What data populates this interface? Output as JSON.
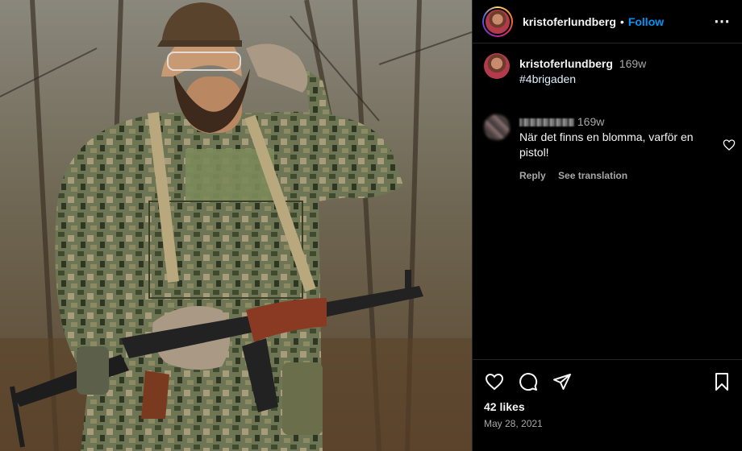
{
  "post": {
    "username": "kristoferlundberg",
    "follow_label": "Follow",
    "more_label": "•••"
  },
  "caption": {
    "username": "kristoferlundberg",
    "time": "169w",
    "text": "#4brigaden"
  },
  "comment": {
    "time": "169w",
    "text": "När det finns en blomma, varför en pistol!",
    "reply_label": "Reply",
    "translate_label": "See translation"
  },
  "footer": {
    "likes": "42 likes",
    "date": "May 28, 2021"
  },
  "icons": {
    "like": "heart-icon",
    "comment": "comment-icon",
    "share": "share-icon",
    "save": "bookmark-icon",
    "more": "more-icon"
  },
  "colors": {
    "accent": "#0095f6",
    "background": "#000000",
    "secondary_text": "#a8a8a8"
  }
}
